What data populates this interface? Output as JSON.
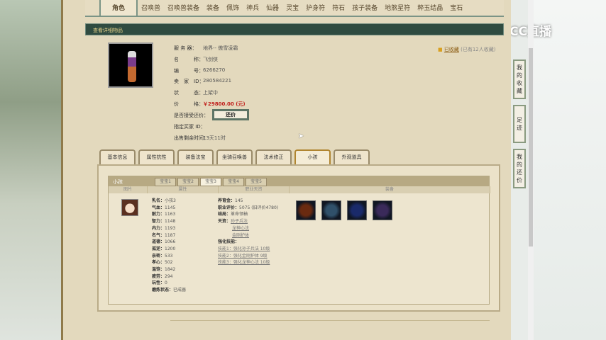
{
  "top_tabs": [
    "角色",
    "召唤兽",
    "召唤兽装备",
    "装备",
    "佩饰",
    "神兵",
    "仙器",
    "灵宝",
    "护身符",
    "符石",
    "孩子装备",
    "地煞星符",
    "粹玉结晶",
    "宝石"
  ],
  "header_title": "查看详细物品",
  "logo": "CC直播",
  "favorite": {
    "link": "已收藏",
    "count_text": "(已有12人收藏)"
  },
  "info": [
    {
      "label": "服 务 器：",
      "value": "地界-- 傲雪凌霜"
    },
    {
      "label": "名　　　称：",
      "value": "飞剑侠"
    },
    {
      "label": "编　　　号：",
      "value": "6266270"
    },
    {
      "label": "卖　家　ID：",
      "value": "280584221"
    },
    {
      "label": "状　　　态：",
      "value": "上架中"
    },
    {
      "label": "价　　　格：",
      "value": "￥29800.00 (元)"
    },
    {
      "label": "是否接受还价：",
      "value": ""
    },
    {
      "label": "指定买家 ID：",
      "value": ""
    },
    {
      "label": "出售剩余时间：",
      "value": "13天11时"
    }
  ],
  "offer_button": "还价",
  "detail_tabs": [
    "基本信息",
    "属性抗性",
    "装备法宝",
    "坐骑召唤兽",
    "法术修正",
    "小孩",
    "外观道具"
  ],
  "active_detail_tab": 5,
  "child_panel": {
    "title": "小孩",
    "baby_tabs": [
      "宝宝1",
      "宝宝2",
      "宝宝3",
      "宝宝4",
      "宝宝5"
    ],
    "active_baby": 2,
    "columns": [
      "图片",
      "属性",
      "职业天资",
      "装备"
    ],
    "attrs": [
      [
        "乳名：",
        "小孩3"
      ],
      [
        "气血：",
        "1145"
      ],
      [
        "耐力：",
        "1163"
      ],
      [
        "智力：",
        "1148"
      ],
      [
        "内力：",
        "1193"
      ],
      [
        "名气：",
        "1187"
      ],
      [
        "道德：",
        "1066"
      ],
      [
        "孤逆：",
        "1200"
      ],
      [
        "亲密：",
        "533"
      ],
      [
        "孝心：",
        "502"
      ],
      [
        "温饱：",
        "1842"
      ],
      [
        "疲劳：",
        "294"
      ],
      [
        "玩性：",
        "0"
      ],
      [
        "磨炼状态：",
        "已成器"
      ]
    ],
    "career": [
      [
        "养育金：",
        "145"
      ],
      [
        "职业评价：",
        "5075 (旧评价4780)"
      ],
      [
        "结局：",
        "革命领袖"
      ],
      [
        "天资：",
        "孙子兵法"
      ],
      [
        "",
        "龙神心法"
      ],
      [
        "",
        "金刚护体"
      ],
      [
        "强化技能：",
        ""
      ],
      [
        "",
        "技能1：强化孙子兵法 10级"
      ],
      [
        "",
        "技能2：强化金刚护体 9级"
      ],
      [
        "",
        "技能3：强化龙神心法 10级"
      ]
    ]
  },
  "sidebar": [
    "我的收藏",
    "足迹",
    "我的还价"
  ]
}
